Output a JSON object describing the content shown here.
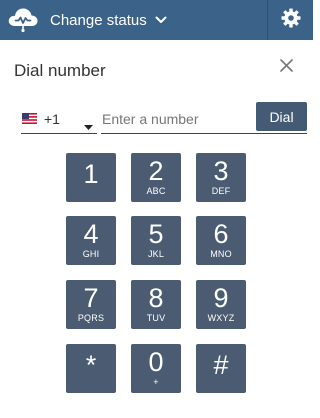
{
  "header": {
    "status_label": "Change status"
  },
  "dialog": {
    "title": "Dial number"
  },
  "dialer": {
    "country_code": "+1",
    "number_value": "",
    "number_placeholder": "Enter a number",
    "dial_label": "Dial"
  },
  "keypad": {
    "keys": [
      {
        "digit": "1",
        "letters": ""
      },
      {
        "digit": "2",
        "letters": "ABC"
      },
      {
        "digit": "3",
        "letters": "DEF"
      },
      {
        "digit": "4",
        "letters": "GHI"
      },
      {
        "digit": "5",
        "letters": "JKL"
      },
      {
        "digit": "6",
        "letters": "MNO"
      },
      {
        "digit": "7",
        "letters": "PQRS"
      },
      {
        "digit": "8",
        "letters": "TUV"
      },
      {
        "digit": "9",
        "letters": "WXYZ"
      },
      {
        "digit": "*",
        "letters": ""
      },
      {
        "digit": "0",
        "letters": "+"
      },
      {
        "digit": "#",
        "letters": ""
      }
    ]
  },
  "colors": {
    "header_bg": "#3b6289",
    "key_bg": "#4a5b72",
    "dial_button_bg": "#455a75"
  },
  "icons": {
    "logo": "cloud-wave-icon",
    "status_caret": "chevron-down-icon",
    "settings": "gear-icon",
    "close": "close-icon",
    "flag": "us-flag-icon",
    "country_caret": "caret-down-icon"
  }
}
